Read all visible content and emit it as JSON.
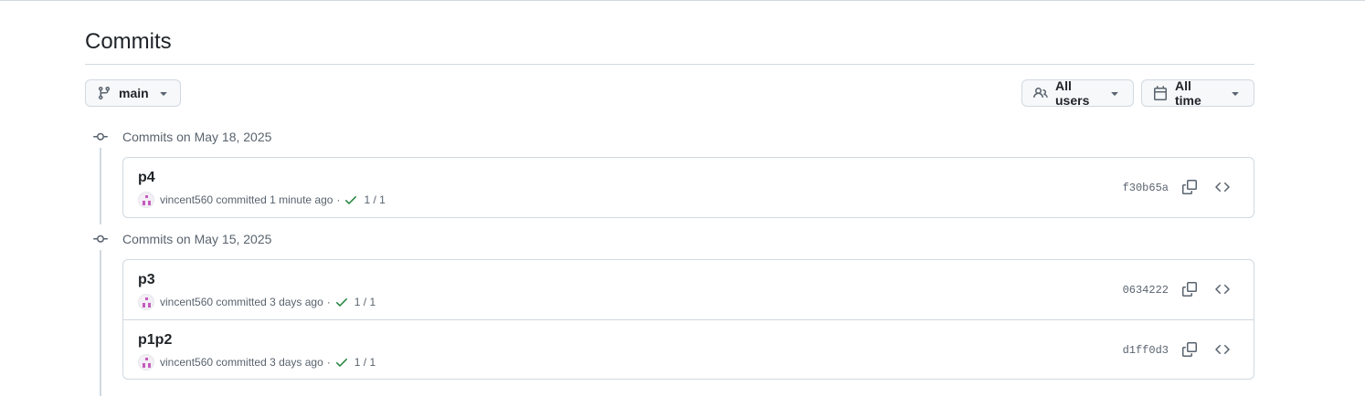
{
  "page": {
    "title": "Commits"
  },
  "filters": {
    "branch_label": "main",
    "users_label": "All users",
    "time_label": "All time"
  },
  "groups": [
    {
      "header": "Commits on May 18, 2025",
      "commits": [
        {
          "message": "p4",
          "author": "vincent560",
          "committed_text": "committed 1 minute ago",
          "status": "1 / 1",
          "sha": "f30b65a"
        }
      ]
    },
    {
      "header": "Commits on May 15, 2025",
      "commits": [
        {
          "message": "p3",
          "author": "vincent560",
          "committed_text": "committed 3 days ago",
          "status": "1 / 1",
          "sha": "0634222"
        },
        {
          "message": "p1p2",
          "author": "vincent560",
          "committed_text": "committed 3 days ago",
          "status": "1 / 1",
          "sha": "d1ff0d3"
        }
      ]
    }
  ],
  "icons": {
    "branch": "git-branch-icon",
    "users": "people-icon",
    "time": "calendar-icon",
    "caret": "triangle-down-icon",
    "commit": "git-commit-icon",
    "check": "check-icon",
    "copy": "copy-icon",
    "browse": "code-icon"
  },
  "colors": {
    "success": "#1a7f37",
    "muted": "#59636e",
    "border": "#d1d9e0"
  }
}
